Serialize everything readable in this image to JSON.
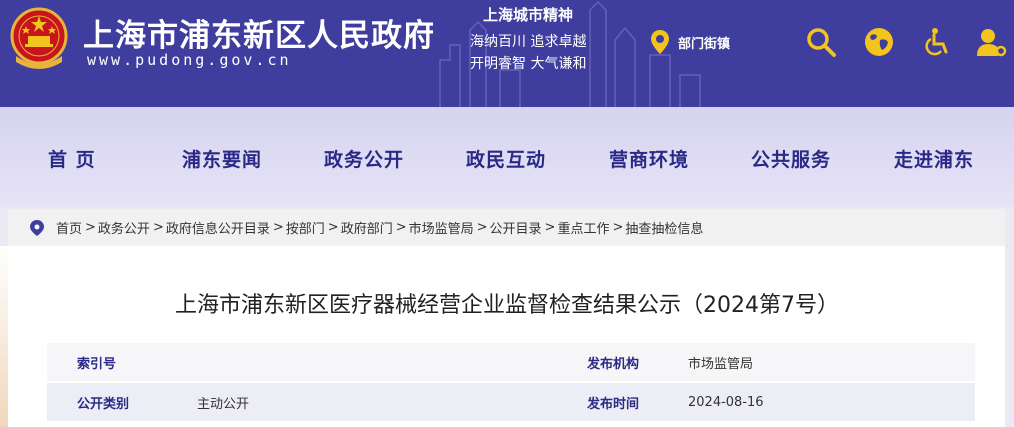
{
  "header": {
    "site_title": "上海市浦东新区人民政府",
    "site_url": "www.pudong.gov.cn",
    "spirit_title": "上海城市精神",
    "spirit_line1": "海纳百川  追求卓越",
    "spirit_line2": "开明睿智  大气谦和",
    "dept_label": "部门街镇",
    "icons": [
      "location-pin-icon",
      "search-icon",
      "globe-icon",
      "wheelchair-icon",
      "user-settings-icon"
    ],
    "colors": {
      "header_bg": "#3f3d9e",
      "icon_gold": "#f2c41c"
    }
  },
  "nav": {
    "items": [
      "首  页",
      "浦东要闻",
      "政务公开",
      "政民互动",
      "营商环境",
      "公共服务",
      "走进浦东"
    ],
    "color": "#2a2a86"
  },
  "breadcrumb": {
    "items": [
      "首页",
      "政务公开",
      "政府信息公开目录",
      "按部门",
      "政府部门",
      "市场监管局",
      "公开目录",
      "重点工作",
      "抽查抽检信息"
    ],
    "separator": ">"
  },
  "article": {
    "title": "上海市浦东新区医疗器械经营企业监督检查结果公示（2024第7号）"
  },
  "meta": {
    "index_label": "索引号",
    "index_value": "",
    "issuer_label": "发布机构",
    "issuer_value": "市场监管局",
    "category_label": "公开类别",
    "category_value": "主动公开",
    "date_label": "发布时间",
    "date_value": "2024-08-16"
  }
}
